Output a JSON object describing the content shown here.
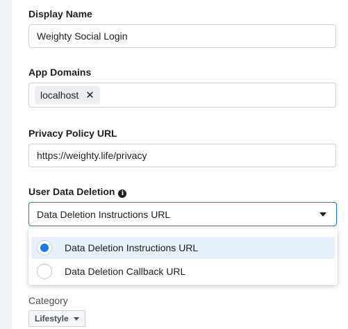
{
  "display_name": {
    "label": "Display Name",
    "value": "Weighty Social Login"
  },
  "app_domains": {
    "label": "App Domains",
    "tags": [
      "localhost"
    ],
    "remove_icon": "close-icon"
  },
  "privacy_policy": {
    "label": "Privacy Policy URL",
    "value": "https://weighty.life/privacy"
  },
  "user_data_deletion": {
    "label": "User Data Deletion",
    "info_icon": "i",
    "selected": "Data Deletion Instructions URL",
    "options": [
      "Data Deletion Instructions URL",
      "Data Deletion Callback URL"
    ]
  },
  "category": {
    "label": "Category",
    "value": "Lifestyle"
  },
  "colors": {
    "accent": "#1877f2",
    "selected_bg": "#e7f0fd"
  }
}
